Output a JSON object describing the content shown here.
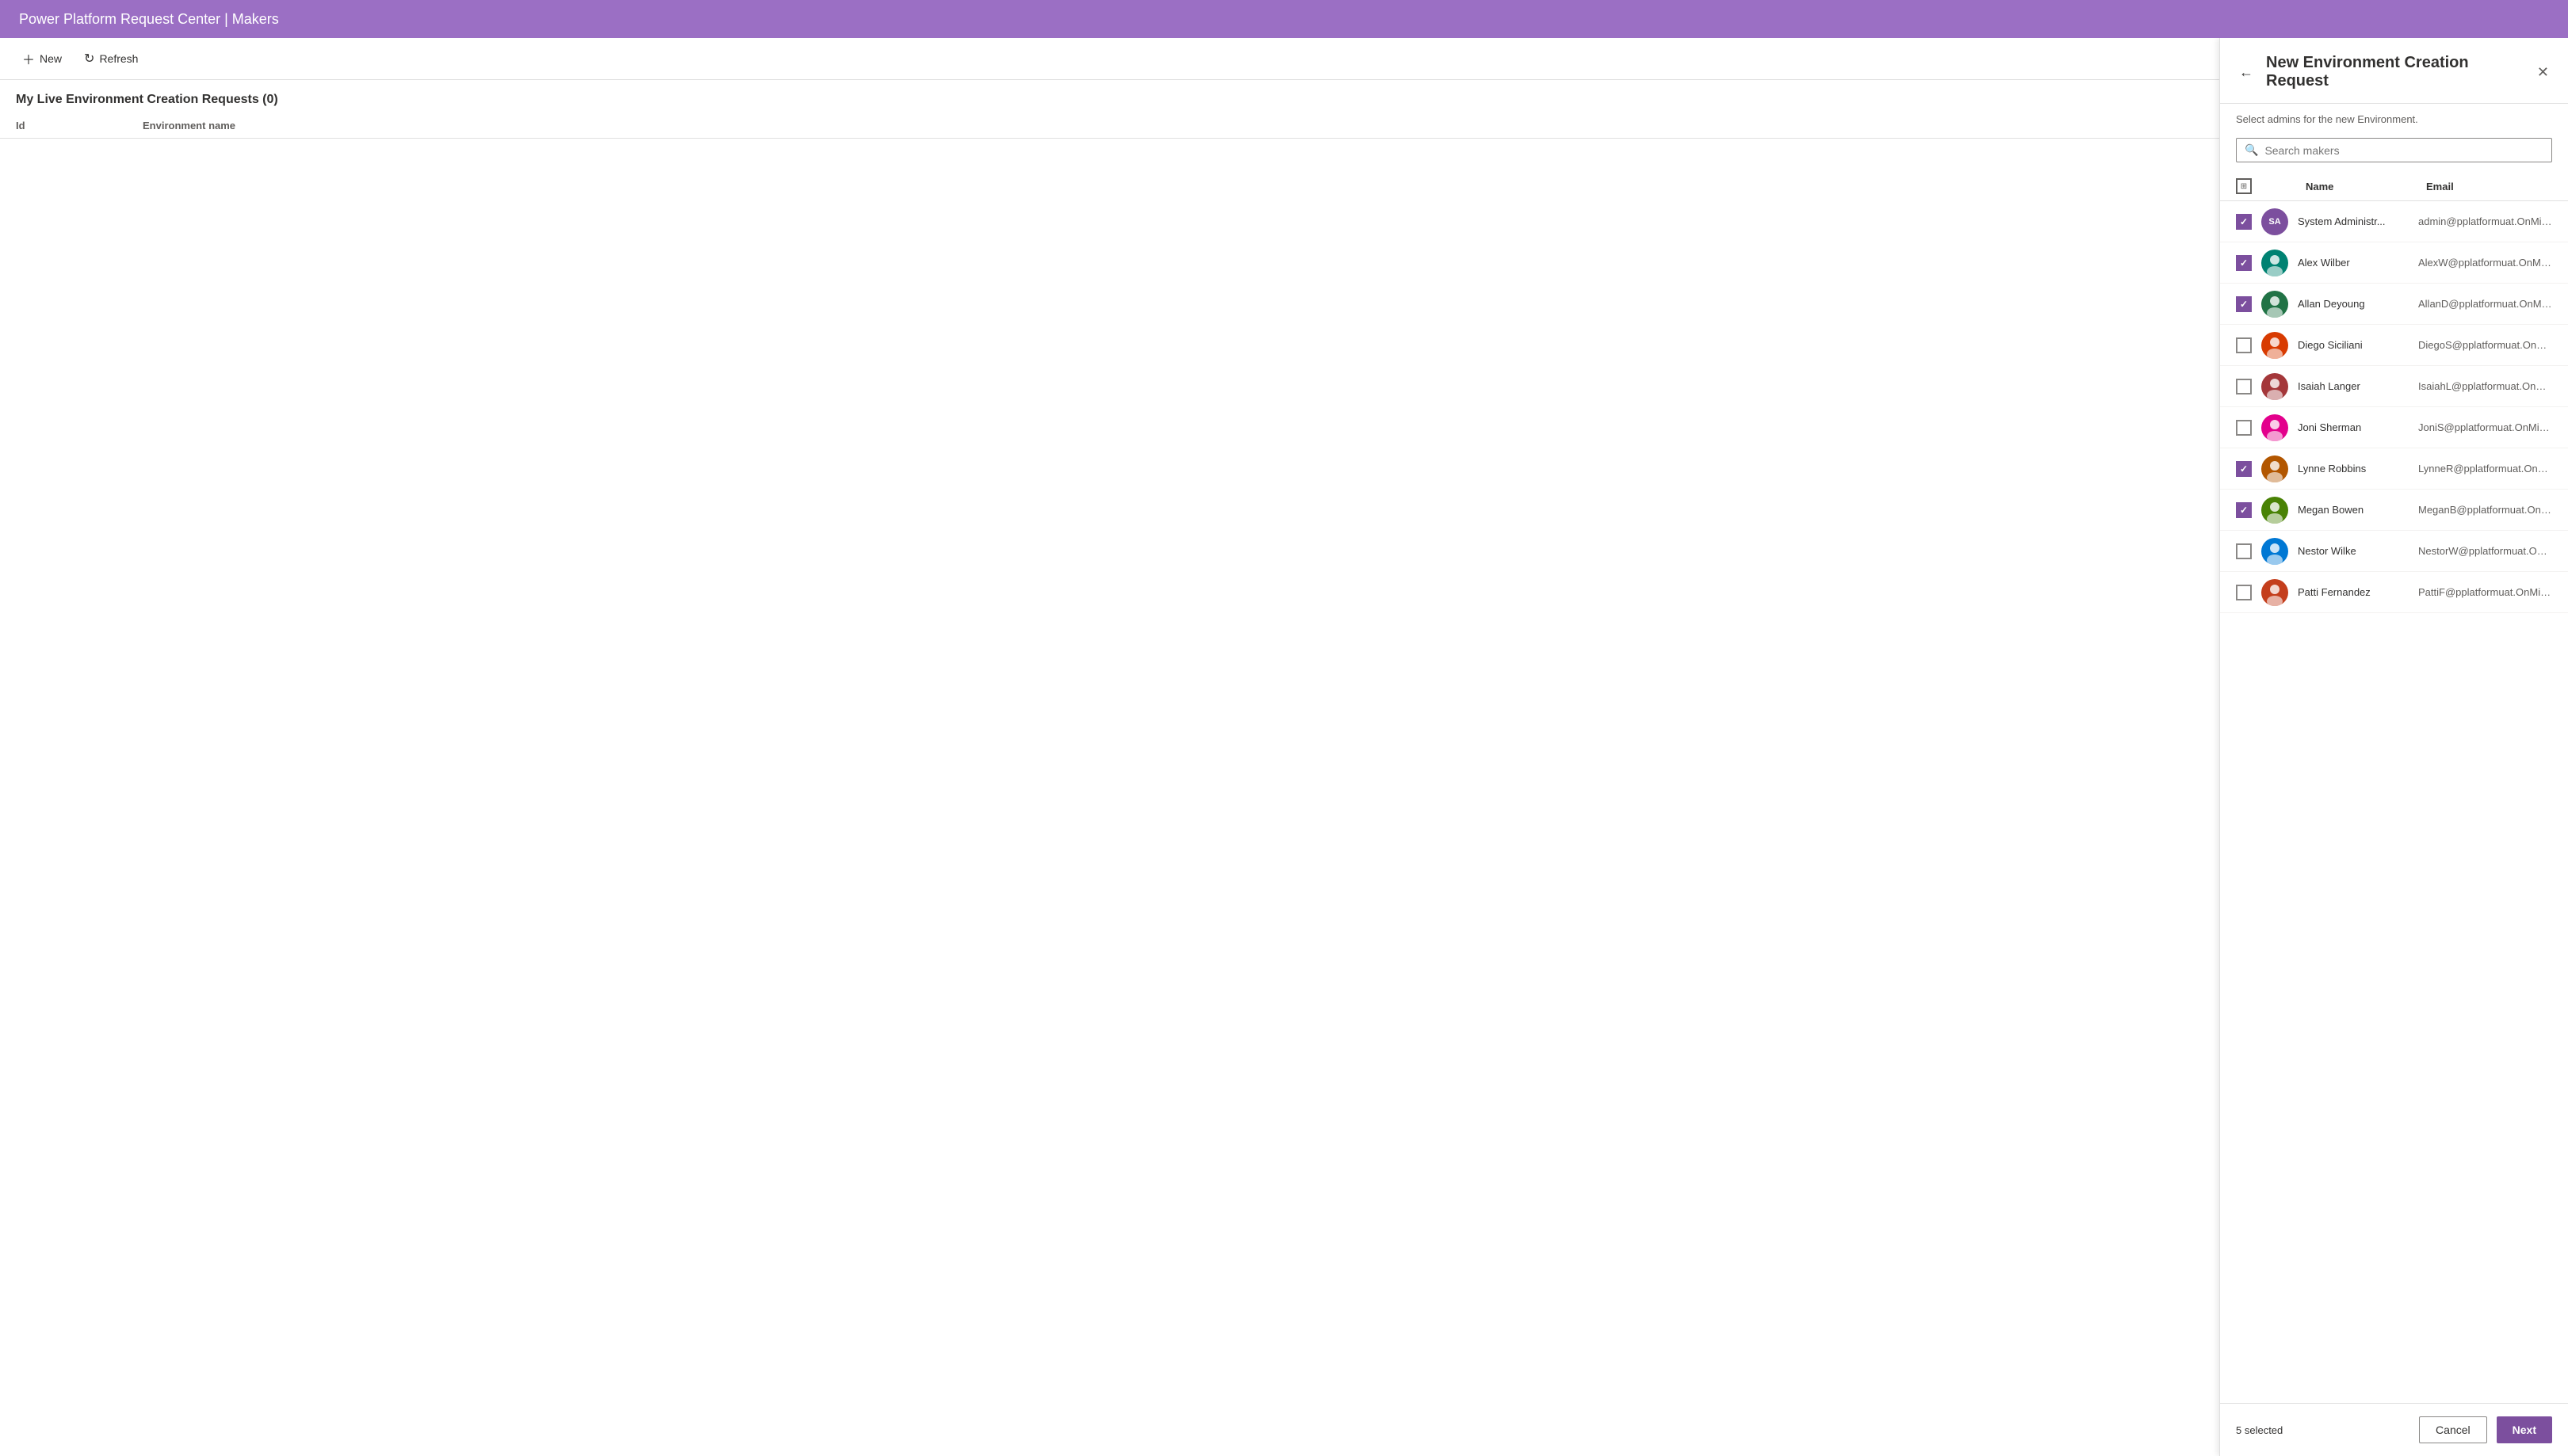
{
  "app": {
    "title": "Power Platform Request Center | Makers"
  },
  "toolbar": {
    "new_label": "New",
    "refresh_label": "Refresh"
  },
  "main": {
    "page_title": "My Live Environment Creation Requests (0)",
    "col_id": "Id",
    "col_env": "Environment name",
    "empty_message": ""
  },
  "panel": {
    "title": "New Environment Creation Request",
    "subtitle": "Select admins for the new Environment.",
    "search_placeholder": "Search makers",
    "col_name": "Name",
    "col_email": "Email",
    "selected_count": "5 selected",
    "cancel_label": "Cancel",
    "next_label": "Next",
    "makers": [
      {
        "id": 1,
        "name": "System Administr...",
        "email": "admin@pplatformuat.OnMicrosoft.co...",
        "checked": true,
        "avatar_type": "initials",
        "initials": "SA",
        "avatar_color": "av-purple"
      },
      {
        "id": 2,
        "name": "Alex Wilber",
        "email": "AlexW@pplatformuat.OnMicrosoft.c...",
        "checked": true,
        "avatar_type": "photo",
        "avatar_color": "av-blue"
      },
      {
        "id": 3,
        "name": "Allan Deyoung",
        "email": "AllanD@pplatformuat.OnMicrosoft.c...",
        "checked": true,
        "avatar_type": "photo",
        "avatar_color": "av-teal"
      },
      {
        "id": 4,
        "name": "Diego Siciliani",
        "email": "DiegoS@pplatformuat.OnMicrosoft.c...",
        "checked": false,
        "avatar_type": "photo",
        "avatar_color": "av-green"
      },
      {
        "id": 5,
        "name": "Isaiah Langer",
        "email": "IsaiahL@pplatformuat.OnMicrosoft.c...",
        "checked": false,
        "avatar_type": "photo",
        "avatar_color": "av-orange"
      },
      {
        "id": 6,
        "name": "Joni Sherman",
        "email": "JoniS@pplatformuat.OnMicrosoft.com",
        "checked": false,
        "avatar_type": "photo",
        "avatar_color": "av-red"
      },
      {
        "id": 7,
        "name": "Lynne Robbins",
        "email": "LynneR@pplatformuat.OnMicrosoft.c...",
        "checked": true,
        "avatar_type": "photo",
        "avatar_color": "av-pink"
      },
      {
        "id": 8,
        "name": "Megan Bowen",
        "email": "MeganB@pplatformuat.OnMicrosoft....",
        "checked": true,
        "avatar_type": "photo",
        "avatar_color": "av-blue"
      },
      {
        "id": 9,
        "name": "Nestor Wilke",
        "email": "NestorW@pplatformuat.OnMicrosoft....",
        "checked": false,
        "avatar_type": "photo",
        "avatar_color": "av-teal"
      },
      {
        "id": 10,
        "name": "Patti Fernandez",
        "email": "PattiF@pplatformuat.OnMicrosoft.com",
        "checked": false,
        "avatar_type": "photo",
        "avatar_color": "av-orange"
      }
    ]
  }
}
